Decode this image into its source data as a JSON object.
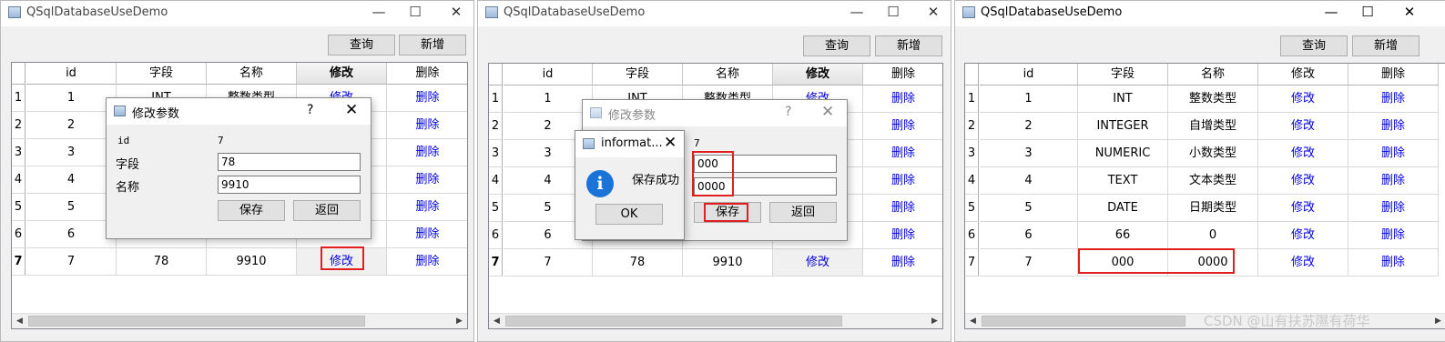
{
  "windows": [
    {
      "title": "QSqlDatabaseUseDemo",
      "query_label": "查询",
      "add_label": "新增",
      "headers": [
        "id",
        "字段",
        "名称",
        "修改",
        "删除"
      ],
      "row_numbers": [
        "1",
        "2",
        "3",
        "4",
        "5",
        "6",
        "7"
      ],
      "rows": [
        [
          "1",
          "INT",
          "整数类型",
          "修改",
          "删除"
        ],
        [
          "2",
          "",
          "",
          "",
          "删除"
        ],
        [
          "3",
          "",
          "",
          "",
          "删除"
        ],
        [
          "4",
          "",
          "",
          "",
          "删除"
        ],
        [
          "5",
          "",
          "",
          "",
          "删除"
        ],
        [
          "6",
          "",
          "",
          "",
          "删除"
        ],
        [
          "7",
          "78",
          "9910",
          "修改",
          "删除"
        ]
      ]
    },
    {
      "title": "QSqlDatabaseUseDemo",
      "query_label": "查询",
      "add_label": "新增",
      "headers": [
        "id",
        "字段",
        "名称",
        "修改",
        "删除"
      ],
      "row_numbers": [
        "1",
        "2",
        "3",
        "4",
        "5",
        "6",
        "7"
      ],
      "rows": [
        [
          "1",
          "INT",
          "整数类型",
          "修改",
          "删除"
        ],
        [
          "2",
          "",
          "",
          "",
          "删除"
        ],
        [
          "3",
          "",
          "",
          "",
          "删除"
        ],
        [
          "4",
          "",
          "",
          "",
          "删除"
        ],
        [
          "5",
          "",
          "",
          "",
          "删除"
        ],
        [
          "6",
          "",
          "",
          "",
          "删除"
        ],
        [
          "7",
          "78",
          "9910",
          "修改",
          "删除"
        ]
      ]
    },
    {
      "title": "QSqlDatabaseUseDemo",
      "query_label": "查询",
      "add_label": "新增",
      "headers": [
        "id",
        "字段",
        "名称",
        "修改",
        "删除"
      ],
      "row_numbers": [
        "1",
        "2",
        "3",
        "4",
        "5",
        "6",
        "7"
      ],
      "rows": [
        [
          "1",
          "INT",
          "整数类型",
          "修改",
          "删除"
        ],
        [
          "2",
          "INTEGER",
          "自增类型",
          "修改",
          "删除"
        ],
        [
          "3",
          "NUMERIC",
          "小数类型",
          "修改",
          "删除"
        ],
        [
          "4",
          "TEXT",
          "文本类型",
          "修改",
          "删除"
        ],
        [
          "5",
          "DATE",
          "日期类型",
          "修改",
          "删除"
        ],
        [
          "6",
          "66",
          "0",
          "修改",
          "删除"
        ],
        [
          "7",
          "000",
          "0000",
          "修改",
          "删除"
        ]
      ]
    }
  ],
  "edit_dialog_1": {
    "title": "修改参数",
    "help": "?",
    "id_label": "id",
    "id_value": "7",
    "field_label": "字段",
    "field_value": "78",
    "name_label": "名称",
    "name_value": "9910",
    "save_label": "保存",
    "back_label": "返回"
  },
  "edit_dialog_2": {
    "title": "修改参数",
    "help": "?",
    "id_value": "7",
    "field_value": "000",
    "name_value": "0000",
    "save_label": "保存",
    "back_label": "返回"
  },
  "info_box": {
    "title": "informat...",
    "message": "保存成功",
    "ok_label": "OK",
    "icon_glyph": "i"
  },
  "watermark": "CSDN @山有扶苏隰有荷华",
  "colors": {
    "link": "#0000e0",
    "highlight": "#e02020",
    "info": "#1a73d6"
  }
}
